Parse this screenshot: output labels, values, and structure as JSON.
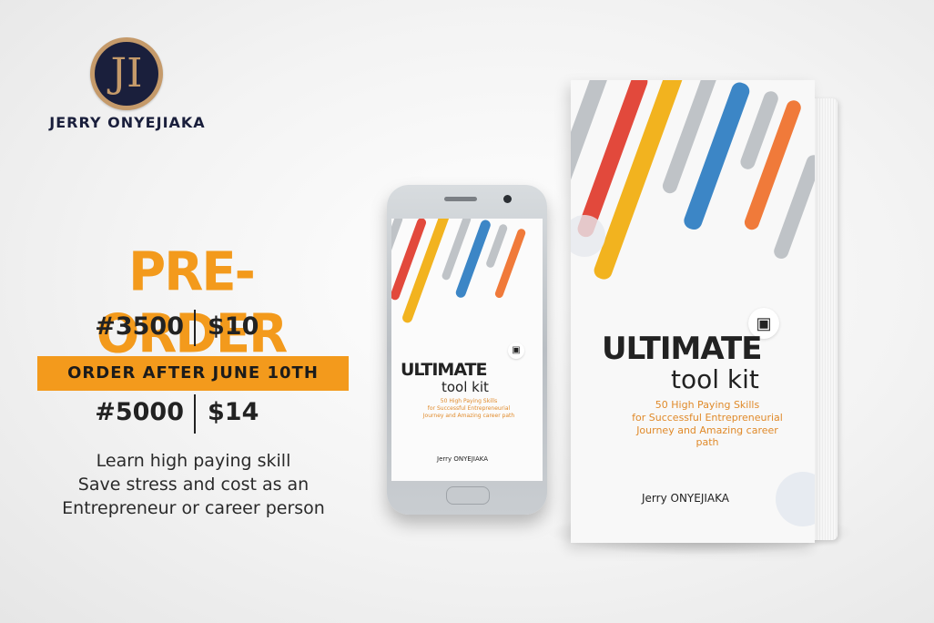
{
  "logo": {
    "monogram": "JI",
    "name": "JERRY ONYEJIAKA"
  },
  "promo": {
    "headline": "PRE-ORDER",
    "price_naira_early": "#3500",
    "price_usd_early": "$10",
    "banner": "ORDER AFTER JUNE 10TH",
    "price_naira_late": "#5000",
    "price_usd_late": "$14"
  },
  "tagline": [
    "Learn high paying skill",
    "Save stress and cost as an",
    "Entrepreneur or career person"
  ],
  "book": {
    "title_line1": "ULTIMATE",
    "title_line2": "tool kit",
    "subtitle_line1": "50 High Paying Skills",
    "subtitle_line2": "for Successful Entrepreneurial",
    "subtitle_line3": "Journey and Amazing career path",
    "author": "Jerry ONYEJIAKA"
  },
  "colors": {
    "accent": "#f39a1c",
    "navy": "#1a1f3c",
    "gold": "#c59a6a",
    "stripe_red": "#e2493c",
    "stripe_blue": "#3c86c6",
    "stripe_yellow": "#f2b31f",
    "stripe_gray": "#bfc3c7",
    "stripe_orange": "#f07a3a"
  }
}
